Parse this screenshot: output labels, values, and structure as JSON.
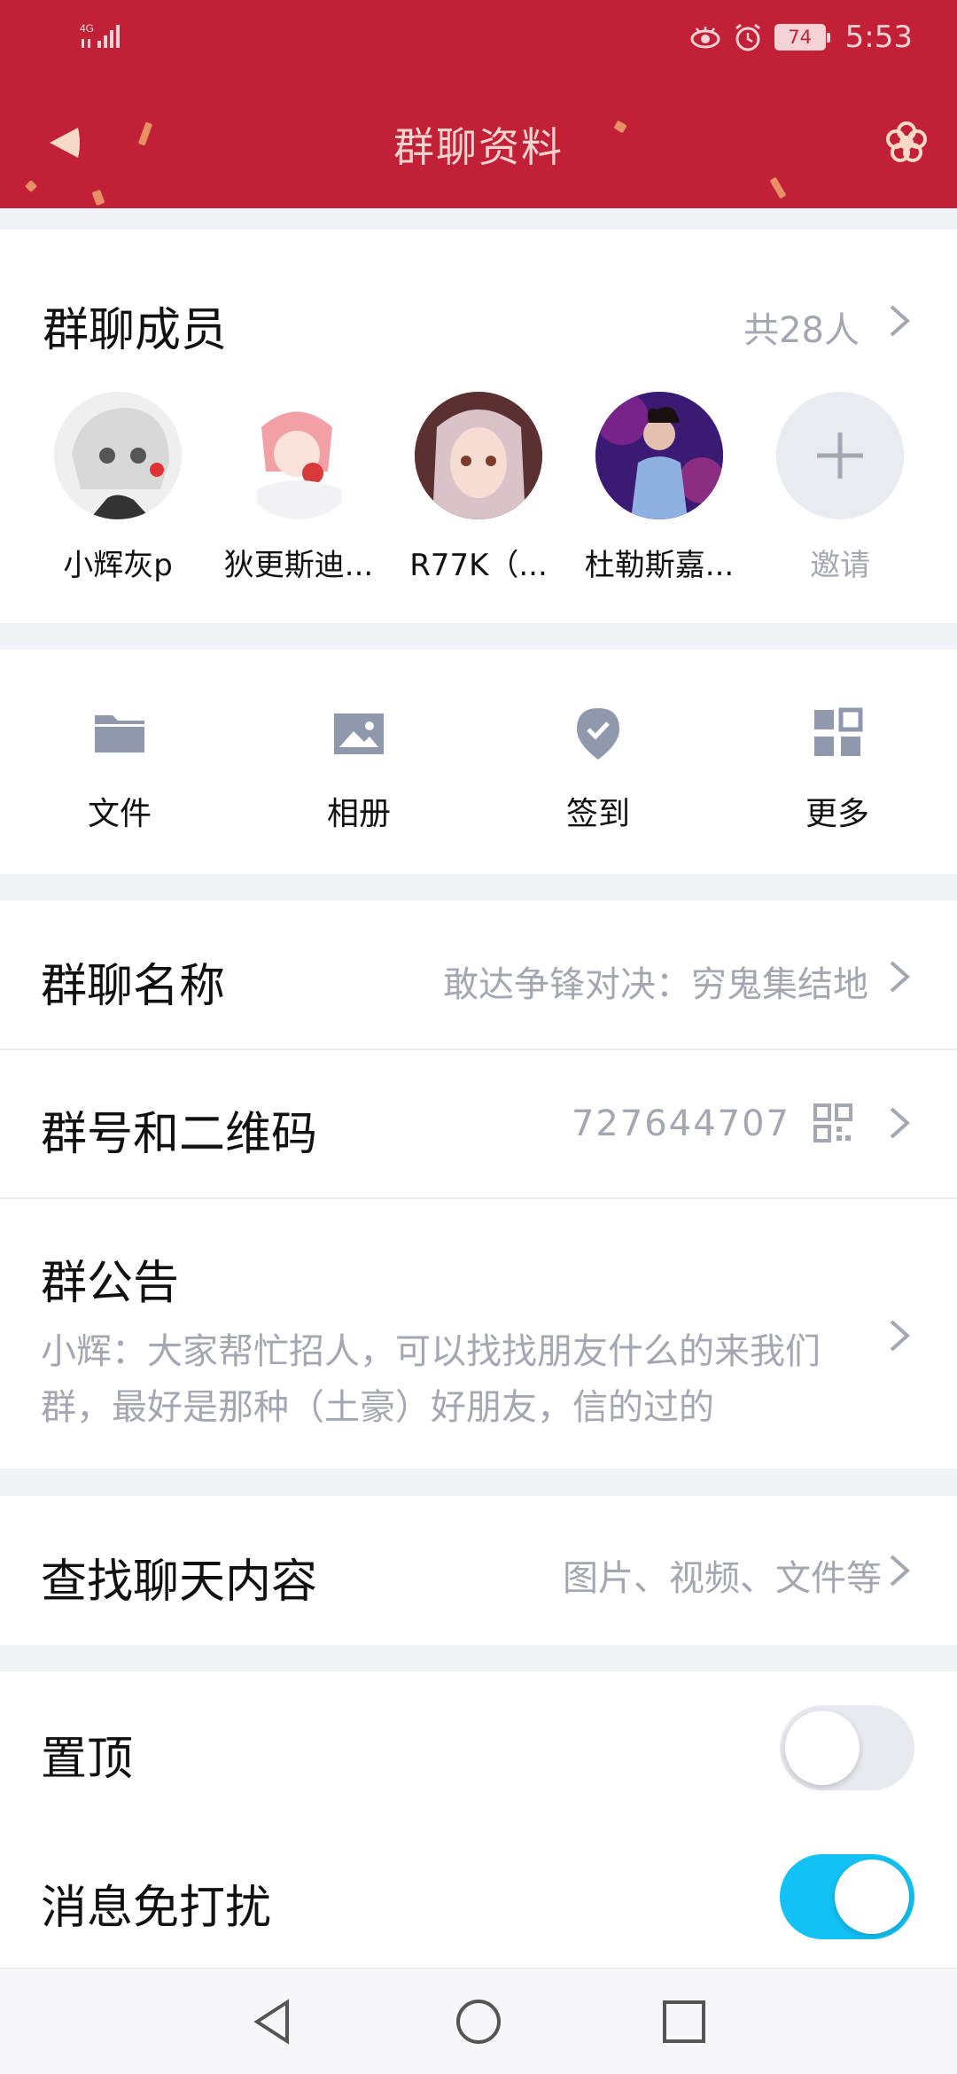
{
  "status_bar": {
    "network": "4G",
    "battery": "74",
    "time": "5:53"
  },
  "header": {
    "title": "群聊资料",
    "back_icon": "back-triangle-icon",
    "menu_icon": "flower-icon"
  },
  "members": {
    "title": "群聊成员",
    "count": "共28人",
    "list": [
      {
        "name": "小辉灰p"
      },
      {
        "name": "狄更斯迪..."
      },
      {
        "name": "R77K（..."
      },
      {
        "name": "杜勒斯嘉..."
      }
    ],
    "invite_label": "邀请"
  },
  "tools": [
    {
      "label": "文件",
      "icon": "folder-icon"
    },
    {
      "label": "相册",
      "icon": "image-icon"
    },
    {
      "label": "签到",
      "icon": "checkin-pin-icon"
    },
    {
      "label": "更多",
      "icon": "grid-icon"
    }
  ],
  "group_info": {
    "name_label": "群聊名称",
    "name_value": "敢达争锋对决：穷鬼集结地",
    "number_label": "群号和二维码",
    "number_value": "727644707",
    "notice_label": "群公告",
    "notice_text": "小辉：大家帮忙招人，可以找找朋友什么的来我们群，最好是那种（土豪）好朋友，信的过的"
  },
  "search": {
    "label": "查找聊天内容",
    "value": "图片、视频、文件等"
  },
  "settings": {
    "pin_label": "置顶",
    "pin_on": false,
    "mute_label": "消息免打扰",
    "mute_on": true
  },
  "colors": {
    "header": "#c22036",
    "toggle_on": "#12c2f5",
    "toggle_off": "#e8eaf0",
    "icon": "#8f98ad"
  }
}
